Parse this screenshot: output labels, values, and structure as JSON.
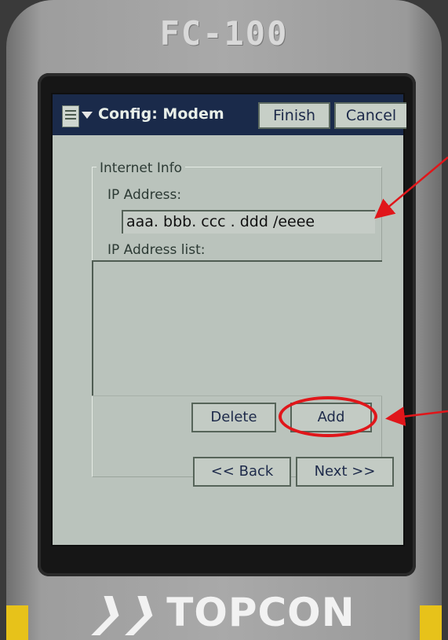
{
  "device": {
    "model": "FC-100",
    "brand": "TOPCON"
  },
  "titlebar": {
    "title": "Config: Modem",
    "finish_label": "Finish",
    "cancel_label": "Cancel"
  },
  "internet_info": {
    "group_label": "Internet Info",
    "ip_address_label": "IP Address:",
    "ip_address_value": "aaa. bbb. ccc . ddd /eeee",
    "ip_list_label": "IP Address list:",
    "ip_list_items": []
  },
  "buttons": {
    "delete_label": "Delete",
    "add_label": "Add",
    "back_label": "<< Back",
    "next_label": "Next >>"
  },
  "colors": {
    "titlebar": "#1a2a4a",
    "screen": "#bac3bc",
    "annotation": "#e0161a",
    "accent_yellow": "#e7c21a"
  }
}
